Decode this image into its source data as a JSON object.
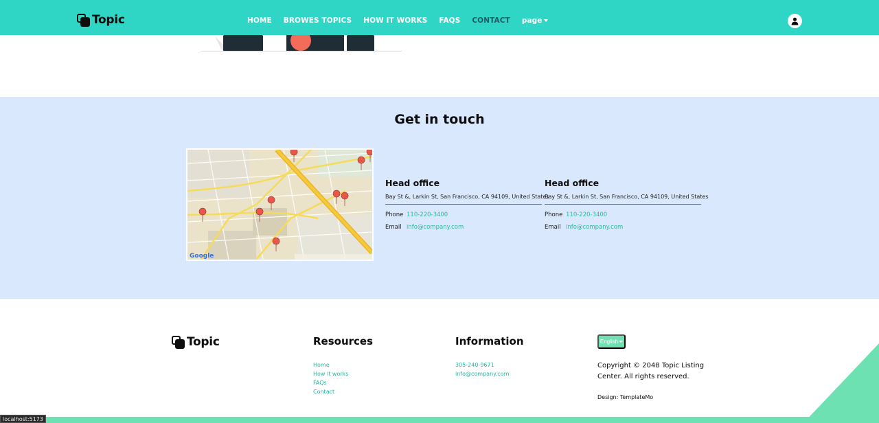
{
  "navbar": {
    "brand": "Topic",
    "links": [
      {
        "label": "HOME"
      },
      {
        "label": "BROWES TOPICS"
      },
      {
        "label": "HOW IT WORKS"
      },
      {
        "label": "FAQS"
      },
      {
        "label": "CONTACT"
      },
      {
        "label": "page"
      }
    ],
    "active_link": "CONTACT",
    "user_icon": "person-icon"
  },
  "contact": {
    "title": "Get in touch",
    "offices": [
      {
        "title": "Head office",
        "address": "Bay St &, Larkin St, San Francisco, CA 94109, United States",
        "phone_label": "Phone",
        "phone": "110-220-3400",
        "email_label": "Email",
        "email": "info@company.com"
      },
      {
        "title": "Head office",
        "address": "Bay St &, Larkin St, San Francisco, CA 94109, United States",
        "phone_label": "Phone",
        "phone": "110-220-3400",
        "email_label": "Email",
        "email": "info@company.com"
      }
    ]
  },
  "footer": {
    "brand": "Topic",
    "resources": {
      "title": "Resources",
      "links": [
        "Home",
        "How it works",
        "FAQs",
        "Contact"
      ]
    },
    "information": {
      "title": "Information",
      "links": [
        "305-240-9671",
        "info@company.com"
      ]
    },
    "language": "English",
    "copyright": "Copyright © 2048 Topic Listing Center. All rights reserved.",
    "design": "Design: TemplateMo"
  },
  "status_bar": {
    "url": "localhost:5173"
  },
  "colors": {
    "navbar": "#2fd6c5",
    "contact_bg": "#dae8fd",
    "accent": "#29b5a0",
    "footer_accent": "#6ee1b3"
  }
}
